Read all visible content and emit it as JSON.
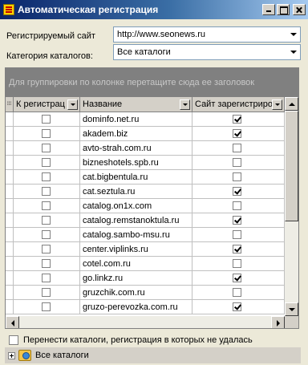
{
  "window": {
    "title": "Автоматическая регистрация",
    "icon": "app-icon"
  },
  "form": {
    "site_label": "Регистрируемый сайт",
    "site_value": "http://www.seonews.ru",
    "category_label": "Категория каталогов:",
    "category_value": "Все каталоги"
  },
  "grid": {
    "group_hint": "Для группировки по колонке перетащите сюда ее заголовок",
    "columns": [
      "К регистрац",
      "Название",
      "Сайт зарегистриро"
    ],
    "rows": [
      {
        "register": false,
        "name": "dominfo.net.ru",
        "registered": true
      },
      {
        "register": false,
        "name": "akadem.biz",
        "registered": true
      },
      {
        "register": false,
        "name": "avto-strah.com.ru",
        "registered": false
      },
      {
        "register": false,
        "name": "bizneshotels.spb.ru",
        "registered": false
      },
      {
        "register": false,
        "name": "cat.bigbentula.ru",
        "registered": false
      },
      {
        "register": false,
        "name": "cat.seztula.ru",
        "registered": true
      },
      {
        "register": false,
        "name": "catalog.on1x.com",
        "registered": false
      },
      {
        "register": false,
        "name": "catalog.remstanoktula.ru",
        "registered": true
      },
      {
        "register": false,
        "name": "catalog.sambo-msu.ru",
        "registered": false
      },
      {
        "register": false,
        "name": "center.viplinks.ru",
        "registered": true
      },
      {
        "register": false,
        "name": "cotel.com.ru",
        "registered": false
      },
      {
        "register": false,
        "name": "go.linkz.ru",
        "registered": true
      },
      {
        "register": false,
        "name": "gruzchik.com.ru",
        "registered": false
      },
      {
        "register": false,
        "name": "gruzo-perevozka.com.ru",
        "registered": true
      }
    ]
  },
  "footer": {
    "transfer_label": "Перенести каталоги, регистрация в которых не удалась",
    "tree_root": "Все каталоги"
  }
}
